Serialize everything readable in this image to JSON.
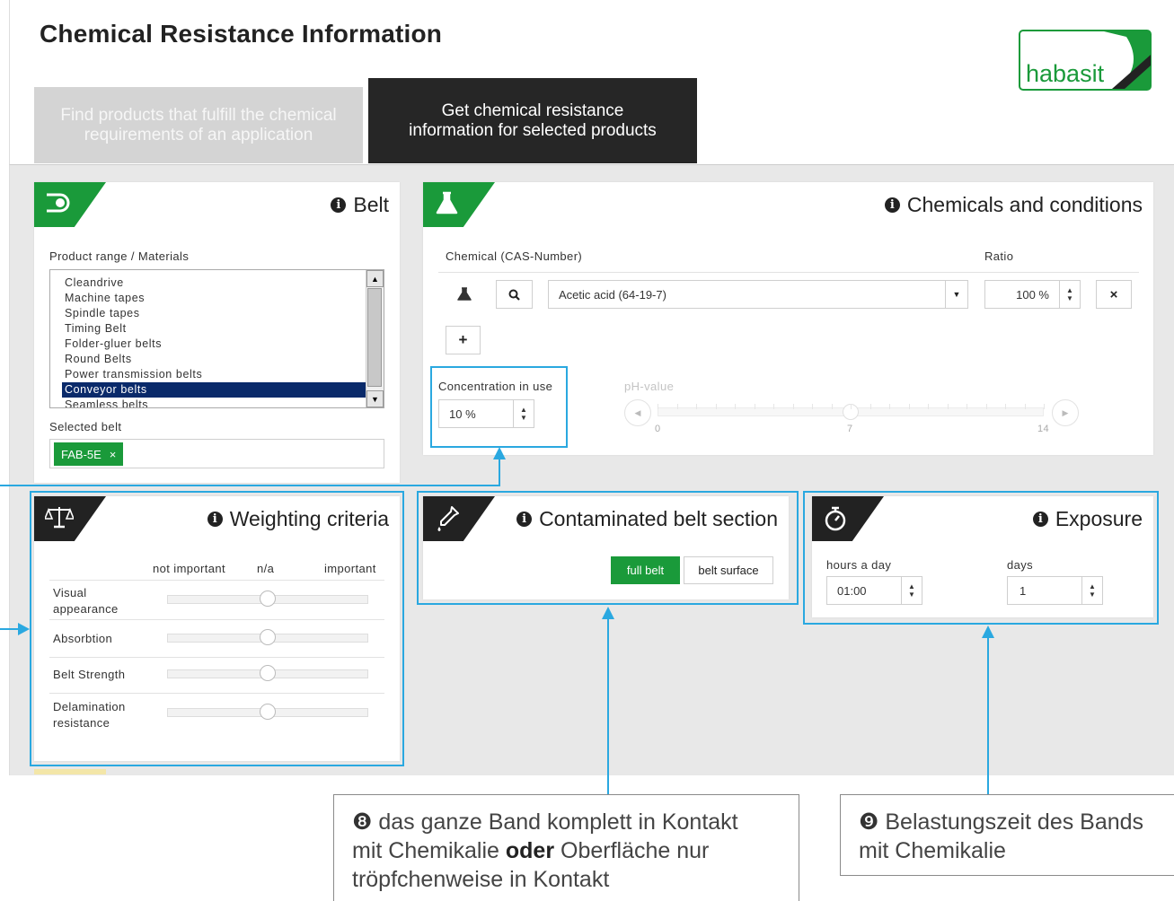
{
  "header": {
    "title": "Chemical Resistance Information",
    "logo_text": "habasit"
  },
  "tabs": [
    {
      "label_line1": "Find products that fulfill the chemical",
      "label_line2": "requirements of an application",
      "active": false
    },
    {
      "label_line1": "Get chemical resistance",
      "label_line2": "information for selected products",
      "active": true
    }
  ],
  "belt": {
    "title": "Belt",
    "icon": "belt-icon",
    "product_range_label": "Product range / Materials",
    "items": [
      "Cleandrive",
      "Machine tapes",
      "Spindle tapes",
      "Timing Belt",
      "Folder-gluer belts",
      "Round Belts",
      "Power transmission belts",
      "Conveyor belts",
      "Seamless belts"
    ],
    "selected_index": 7,
    "selected_belt_label": "Selected belt",
    "selected_chip": "FAB-5E",
    "chip_remove": "×"
  },
  "chemicals": {
    "title": "Chemicals and conditions",
    "icon": "flask-icon",
    "chemical_label": "Chemical (CAS-Number)",
    "ratio_label": "Ratio",
    "chemical_value": "Acetic acid (64-19-7)",
    "ratio_value": "100 %",
    "add_label": "+",
    "remove_label": "×",
    "concentration_label": "Concentration in use",
    "concentration_value": "10 %",
    "ph_label": "pH-value",
    "ph_ticks": [
      "0",
      "7",
      "14"
    ],
    "ph_value": 7,
    "ph_min": 0,
    "ph_max": 14
  },
  "weighting": {
    "title": "Weighting criteria",
    "icon": "scale-icon",
    "col_not_important": "not important",
    "col_na": "n/a",
    "col_important": "important",
    "rows": [
      {
        "label_line1": "Visual",
        "label_line2": "appearance",
        "value": 0.5
      },
      {
        "label_line1": "Absorbtion",
        "label_line2": "",
        "value": 0.5
      },
      {
        "label_line1": "Belt Strength",
        "label_line2": "",
        "value": 0.5
      },
      {
        "label_line1": "Delamination",
        "label_line2": "resistance",
        "value": 0.5
      }
    ]
  },
  "contaminated": {
    "title": "Contaminated belt section",
    "icon": "dropper-icon",
    "full_belt": "full belt",
    "belt_surface": "belt surface"
  },
  "exposure": {
    "title": "Exposure",
    "icon": "stopwatch-icon",
    "hours_label": "hours a day",
    "hours_value": "01:00",
    "days_label": "days",
    "days_value": "1"
  },
  "callouts": {
    "c8_num": "❽",
    "c8_line1": "das ganze Band komplett in Kontakt",
    "c8_line2a": "mit Chemikalie ",
    "c8_bold": "oder",
    "c8_line2b": " Oberfläche nur",
    "c8_line3": "tröpfchenweise in Kontakt",
    "c9_num": "❾",
    "c9_line1": "Belastungszeit des Bands",
    "c9_line2": "mit Chemikalie"
  },
  "colors": {
    "accent": "#1a9a3a",
    "dark": "#262626",
    "highlight": "#2aa8e0",
    "selection": "#0a2a6a"
  }
}
